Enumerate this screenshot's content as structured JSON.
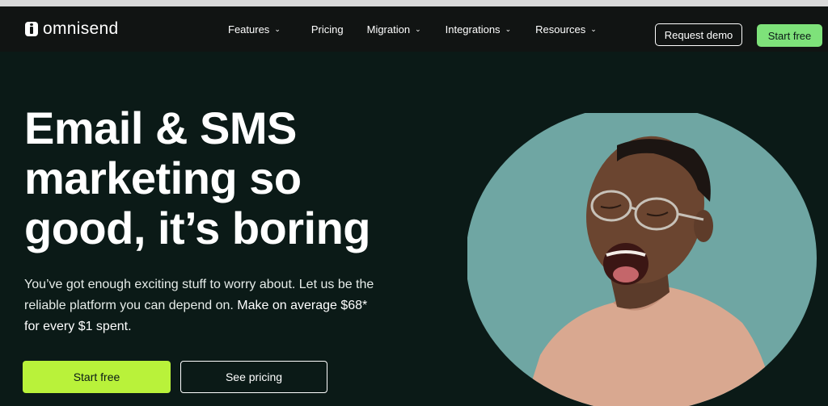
{
  "nav": {
    "logo_text": "omnisend",
    "links": [
      {
        "label": "Features",
        "dropdown": true
      },
      {
        "label": "Pricing",
        "dropdown": false
      },
      {
        "label": "Migration",
        "dropdown": true
      },
      {
        "label": "Integrations",
        "dropdown": true
      },
      {
        "label": "Resources",
        "dropdown": true
      }
    ],
    "request_demo": "Request demo",
    "start_free": "Start free"
  },
  "hero": {
    "title_lines": [
      "Email & SMS",
      "marketing so",
      "good, it’s boring"
    ],
    "subtitle_normal": "You’ve got enough exciting stuff to worry about. Let us be the reliable platform you can depend on. ",
    "subtitle_bold": "Make on average $68* for every $1 spent.",
    "cta_primary": "Start free",
    "cta_secondary": "See pricing"
  },
  "colors": {
    "background": "#0b1a17",
    "nav_background": "#111413",
    "accent_green": "#7ee27a",
    "cta_lime": "#b9f23a",
    "image_circle": "#6fa6a3"
  },
  "icons": {
    "logo": "omnisend-logo-icon",
    "dropdown": "chevron-down-icon"
  }
}
